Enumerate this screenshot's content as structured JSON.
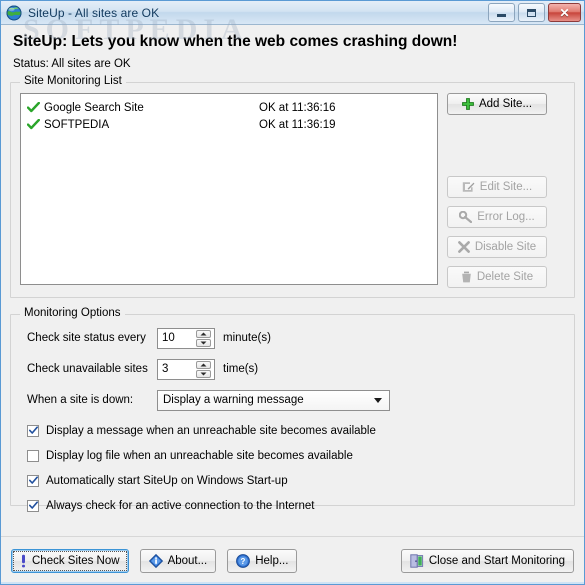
{
  "window": {
    "title": "SiteUp - All sites are OK",
    "icon": "globe-icon",
    "watermark": "SOFTPEDIA",
    "controls": {
      "minimize": "minimize-icon",
      "maximize": "maximize-icon",
      "close": "✕"
    }
  },
  "header": {
    "headline": "SiteUp: Lets you know when the web comes crashing down!",
    "status": "Status: All sites are OK"
  },
  "monitoring_list": {
    "legend": "Site Monitoring List",
    "rows": [
      {
        "icon": "green-check-icon",
        "name": "Google Search Site",
        "status": "OK at 11:36:16"
      },
      {
        "icon": "green-check-icon",
        "name": "SOFTPEDIA",
        "status": "OK at 11:36:19"
      }
    ],
    "buttons": [
      {
        "label": "Add Site...",
        "icon": "green-plus-icon",
        "enabled": true
      },
      {
        "label": "Edit Site...",
        "icon": "pencil-edit-icon",
        "enabled": false
      },
      {
        "label": "Error Log...",
        "icon": "key-icon",
        "enabled": false
      },
      {
        "label": "Disable Site",
        "icon": "x-mark-icon",
        "enabled": false
      },
      {
        "label": "Delete Site",
        "icon": "trash-icon",
        "enabled": false
      }
    ]
  },
  "monitoring_options": {
    "legend": "Monitoring Options",
    "check_interval": {
      "label": "Check site status every",
      "value": "10",
      "unit": "minute(s)"
    },
    "retry_count": {
      "label": "Check unavailable sites",
      "value": "3",
      "unit": "time(s)"
    },
    "down_action": {
      "label": "When a site is down:",
      "value": "Display a warning message",
      "options": [
        "Display a warning message"
      ]
    },
    "checkboxes": [
      {
        "label": "Display a message when an unreachable site becomes available",
        "checked": true
      },
      {
        "label": "Display log file when an unreachable site becomes available",
        "checked": false
      },
      {
        "label": "Automatically start SiteUp on Windows Start-up",
        "checked": true
      },
      {
        "label": "Always check for an active connection to the Internet",
        "checked": true
      }
    ]
  },
  "footer": {
    "buttons": [
      {
        "label": "Check Sites Now",
        "icon": "exclamation-icon",
        "focused": true
      },
      {
        "label": "About...",
        "icon": "info-icon",
        "focused": false
      },
      {
        "label": "Help...",
        "icon": "question-icon",
        "focused": false
      }
    ],
    "primary": {
      "label": "Close and Start Monitoring",
      "icon": "exit-door-icon"
    }
  },
  "colors": {
    "accent": "#3c94d6",
    "ok_green": "#2aa52a",
    "close_red": "#c8453c",
    "panel_bg": "#f0f0f0"
  }
}
